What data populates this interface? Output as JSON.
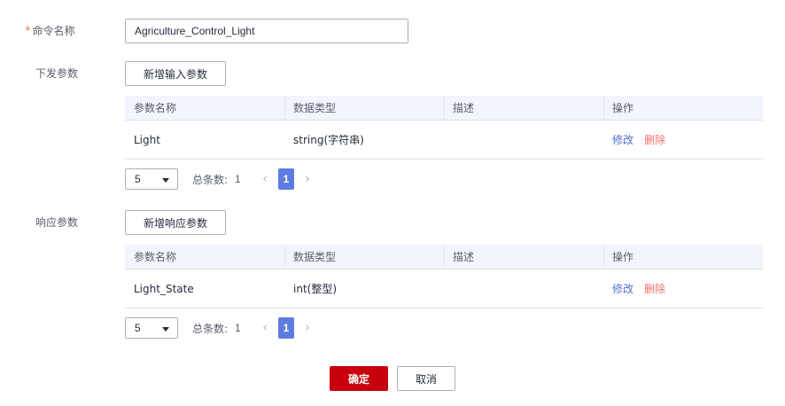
{
  "form": {
    "command_name_label": "命令名称",
    "required_mark": "*",
    "command_name_value": "Agriculture_Control_Light",
    "input_params_label": "下发参数",
    "add_input_button": "新增输入参数",
    "response_params_label": "响应参数",
    "add_response_button": "新增响应参数",
    "confirm_button": "确定",
    "cancel_button": "取消"
  },
  "table_columns": [
    "参数名称",
    "数据类型",
    "描述",
    "操作"
  ],
  "input_table": {
    "rows": [
      {
        "name": "Light",
        "type": "string(字符串)",
        "desc": "",
        "edit": "修改",
        "delete": "删除"
      }
    ]
  },
  "response_table": {
    "rows": [
      {
        "name": "Light_State",
        "type": "int(整型)",
        "desc": "",
        "edit": "修改",
        "delete": "删除"
      }
    ]
  },
  "input_pager": {
    "page_size": "5",
    "total_label": "总条数:",
    "total": "1",
    "current_page": "1",
    "prev": "‹",
    "next": "›"
  },
  "response_pager": {
    "page_size": "5",
    "total_label": "总条数:",
    "total": "1",
    "current_page": "1",
    "prev": "‹",
    "next": "›"
  },
  "colors": {
    "primary": "#c7000b",
    "pager_active": "#5e7ce0",
    "link": "#526ecc",
    "danger": "#f66f6a",
    "table_header_bg": "#f2f5fc"
  }
}
